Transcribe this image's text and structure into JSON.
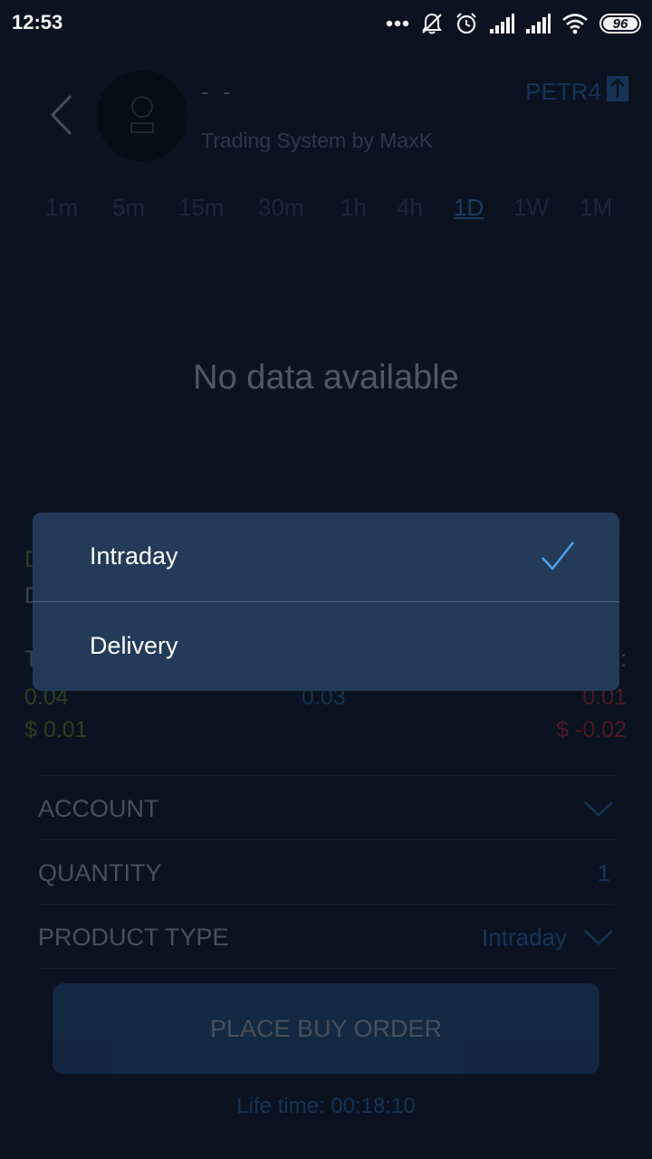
{
  "status_bar": {
    "time": "12:53",
    "battery": "96"
  },
  "header": {
    "title": "- -",
    "subtitle": "Trading System by MaxK",
    "ticker": "PETR4"
  },
  "timeframes": [
    "1m",
    "5m",
    "15m",
    "30m",
    "1h",
    "4h",
    "1D",
    "1W",
    "1M"
  ],
  "active_timeframe": "1D",
  "chart": {
    "empty_text": "No data available"
  },
  "stats": {
    "left_top_partial": "D",
    "left_mid_partial": "D",
    "left_label_partial": "T",
    "right_label_partial": "s:",
    "left_value": "0.04",
    "left_money": "$ 0.01",
    "mid_value": "0.03",
    "right_value": "0.01",
    "right_money": "$ -0.02"
  },
  "form": {
    "account_label": "ACCOUNT",
    "quantity_label": "QUANTITY",
    "quantity_value": "1",
    "product_type_label": "PRODUCT TYPE",
    "product_type_value": "Intraday"
  },
  "buy_button": "PLACE BUY ORDER",
  "lifetime": "Life time: 00:18:10",
  "popup": {
    "options": [
      {
        "label": "Intraday",
        "selected": true
      },
      {
        "label": "Delivery",
        "selected": false
      }
    ]
  },
  "colors": {
    "background": "#0b1320",
    "popup": "#233a58",
    "accent": "#2e78c8",
    "check": "#4d9fe8",
    "positive": "#6f9c1e",
    "negative": "#d02a2a"
  }
}
